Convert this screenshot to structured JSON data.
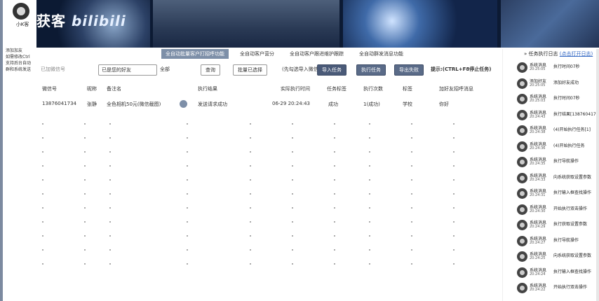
{
  "user": {
    "name": "小K客"
  },
  "sidebar_actions": [
    "添加加友",
    "如需修改Ctrl",
    "支持后台自动",
    "群和系统发送"
  ],
  "banner": {
    "brand_left": "获客",
    "brand_right": "bilibili"
  },
  "tabs": [
    {
      "label": "全自动批量客户打招呼功能",
      "active": true
    },
    {
      "label": "全自动客户营分",
      "active": false
    },
    {
      "label": "全自动客户跟进维护跟踪",
      "active": false
    },
    {
      "label": "全自动群发消息功能",
      "active": false
    }
  ],
  "toolbar": {
    "select_label": "已是您的好友",
    "filter_label": "全部",
    "search_btn": "查询",
    "reset_btn": "批量已选择",
    "import_hint": "(先勾选导入微信)",
    "import_btn": "导入任务",
    "stop_btn": "执行任务",
    "export_btn": "导出失败",
    "hotkey": "提示:(CTRL+F8停止任务)",
    "account_label": "已加微信号"
  },
  "table": {
    "headers": [
      "微信号",
      "昵称",
      "备注名",
      "执行结果",
      "实际执行时间",
      "任务标签",
      "执行次数",
      "标签",
      "加好友招呼消息"
    ],
    "rows": [
      {
        "wx": "13876041734",
        "nick": "张静",
        "remark": "全色相机50元(微信截图)",
        "result": "发送请求成功",
        "time": "06-29 20:24:43",
        "task": "成功",
        "count": "1(成功)",
        "tag": "学校",
        "msg": "你好"
      }
    ]
  },
  "log": {
    "title": "任务执行日志",
    "link": "(点击打开日志)",
    "items": [
      {
        "src": "系统消息",
        "time": "20:25:05",
        "msg": "执行时间07秒"
      },
      {
        "src": "添加好友",
        "time": "20:25:05",
        "msg": "添加好友成功"
      },
      {
        "src": "系统消息",
        "time": "20:25:03",
        "msg": "执行时间07秒"
      },
      {
        "src": "系统消息",
        "time": "20:24:43",
        "msg": "执行结果[13876041734]"
      },
      {
        "src": "系统消息",
        "time": "20:24:38",
        "msg": "(4)开始执行任务[1]"
      },
      {
        "src": "系统消息",
        "time": "20:24:36",
        "msg": "(4)开始执行任务"
      },
      {
        "src": "系统消息",
        "time": "20:24:35",
        "msg": "执行导航操作"
      },
      {
        "src": "系统消息",
        "time": "20:24:33",
        "msg": "向系统获取设置参数"
      },
      {
        "src": "系统消息",
        "time": "20:24:31",
        "msg": "执行输入框查找操作"
      },
      {
        "src": "系统消息",
        "time": "20:24:30",
        "msg": "开始执行双击操作"
      },
      {
        "src": "系统消息",
        "time": "20:24:29",
        "msg": "执行获取设置参数"
      },
      {
        "src": "系统消息",
        "time": "20:24:27",
        "msg": "执行导航操作"
      },
      {
        "src": "系统消息",
        "time": "20:24:25",
        "msg": "向系统获取设置参数"
      },
      {
        "src": "系统消息",
        "time": "20:24:24",
        "msg": "执行输入框查找操作"
      },
      {
        "src": "系统消息",
        "time": "20:24:22",
        "msg": "开始执行双击操作"
      }
    ]
  }
}
